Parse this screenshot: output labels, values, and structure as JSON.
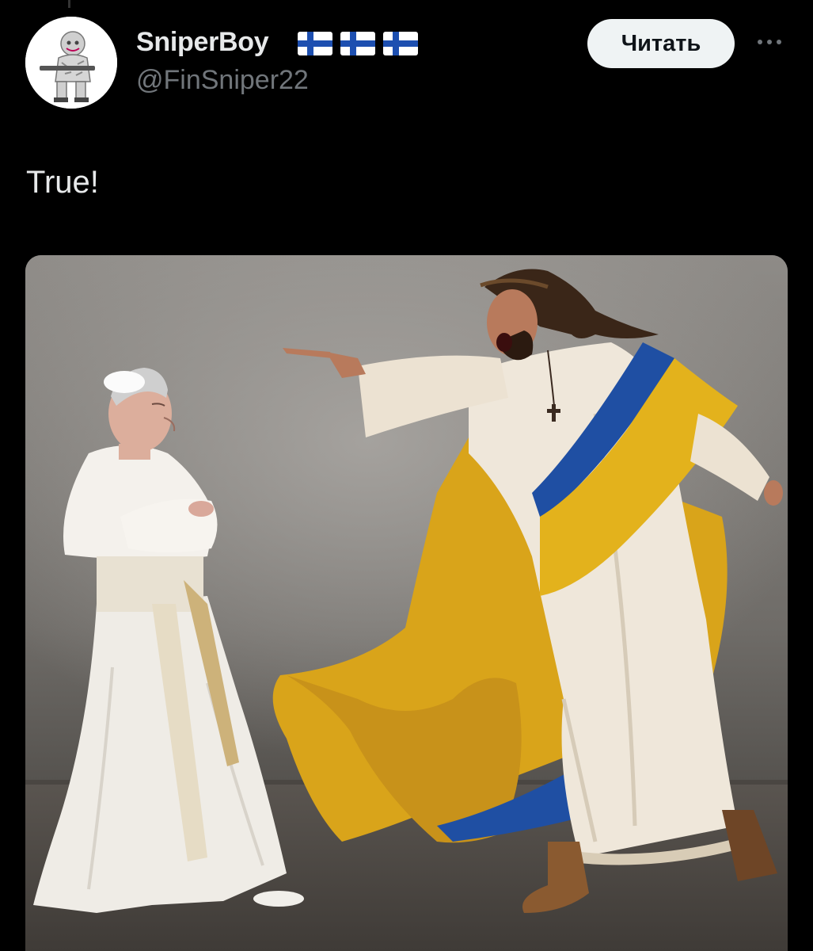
{
  "tweet": {
    "author": {
      "display_name": "SniperBoy",
      "flags": [
        "finland-flag",
        "finland-flag",
        "finland-flag"
      ],
      "handle": "@FinSniper22"
    },
    "follow_label": "Читать",
    "more_icon": "more-horizontal-icon",
    "text": "True!",
    "media": {
      "kind": "image"
    }
  },
  "colors": {
    "background": "#000000",
    "primary_text": "#e7e9ea",
    "secondary_text": "#71767b",
    "button_bg": "#eff3f4",
    "flag_blue": "#1d4fb0",
    "ukraine_blue": "#1f4fa3",
    "ukraine_yellow": "#e0ad1a"
  }
}
